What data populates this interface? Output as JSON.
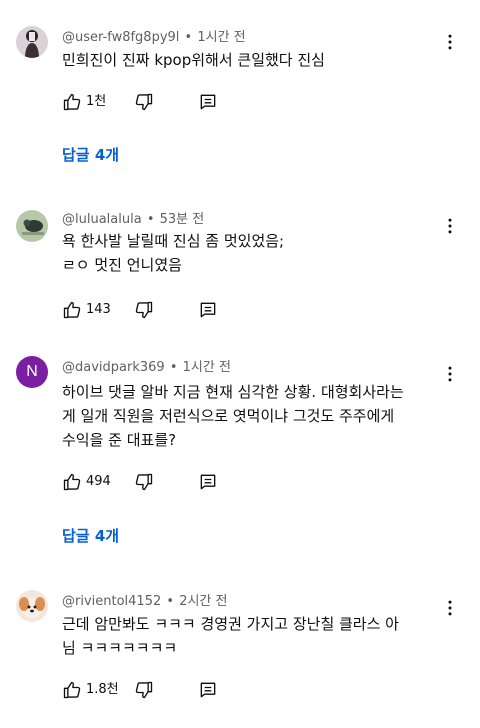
{
  "comments": [
    {
      "author": "@user-fw8fg8py9l",
      "time": "1시간 전",
      "lines": [
        "민희진이 진짜 kpop위해서 큰일했다 진심"
      ],
      "likes": "1천",
      "replies": "답글 4개"
    },
    {
      "author": "@lulualalula",
      "time": "53분 전",
      "lines": [
        "욕 한사발 날릴때 진심 좀 멋있었음;",
        "ㄹㅇ 멋진 언니였음"
      ],
      "likes": "143",
      "replies": null
    },
    {
      "author": "@davidpark369",
      "time": "1시간 전",
      "avatar_letter": "N",
      "lines": [
        "하이브 댓글 알바 지금 현재 심각한 상황. 대형회사라는",
        "게 일개 직원을 저런식으로 엿먹이냐 그것도 주주에게",
        "수익을 준 대표를?"
      ],
      "likes": "494",
      "replies": "답글 4개"
    },
    {
      "author": "@rivientol4152",
      "time": "2시간 전",
      "lines": [
        "근데 암만봐도 ㅋㅋㅋ 경영권 가지고 장난칠 클라스 아",
        "님 ㅋㅋㅋㅋㅋㅋㅋ"
      ],
      "likes": "1.8천",
      "replies": null
    }
  ],
  "separator": "•",
  "colors": {
    "link_blue": "#065fd4",
    "meta_gray": "#606060",
    "avatar_purple": "#7b1fa2"
  },
  "icons": [
    "like-icon",
    "dislike-icon",
    "reply-icon",
    "more-vert-icon"
  ]
}
